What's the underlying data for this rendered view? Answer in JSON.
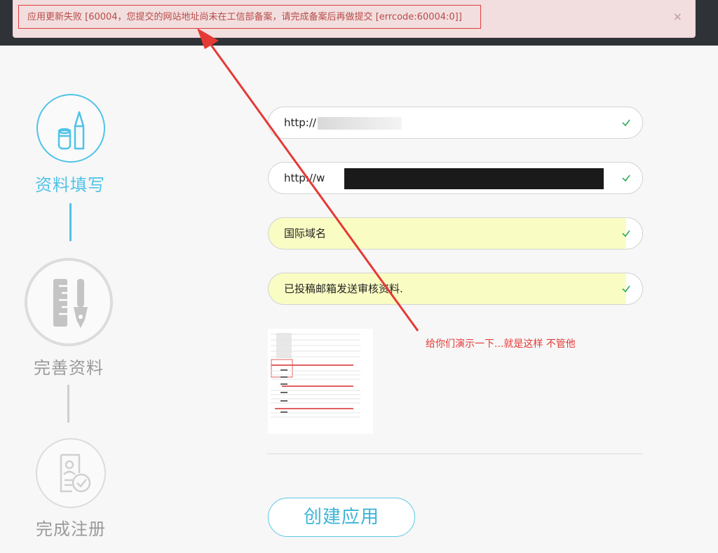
{
  "error_banner": {
    "message": "应用更新失败 [60004，您提交的网站地址尚未在工信部备案，请完成备案后再做提交 [errcode:60004:0]]",
    "close_symbol": "×"
  },
  "steps": [
    {
      "label": "资料填写",
      "icon": "pencil-ruler-icon",
      "state": "active"
    },
    {
      "label": "完善资料",
      "icon": "ruler-pen-icon",
      "state": "inactive"
    },
    {
      "label": "完成注册",
      "icon": "certificate-check-icon",
      "state": "inactive"
    }
  ],
  "form": {
    "fields": [
      {
        "value": "http://",
        "redacted": true,
        "valid": true
      },
      {
        "value": "http://w",
        "redacted": true,
        "valid": true
      },
      {
        "value": "国际域名",
        "valid": true
      },
      {
        "value": "已投稿邮箱发送审核资料.",
        "valid": true
      }
    ]
  },
  "annotation": {
    "text": "给你们演示一下...就是这样 不管他"
  },
  "actions": {
    "create_label": "创建应用"
  },
  "colors": {
    "accent": "#3db5d8",
    "active_step": "#4fc3e8",
    "inactive_step": "#c8c8c8",
    "valid_check": "#2eaa5c",
    "error_text": "#b94a48",
    "annotation_red": "#e53935",
    "autofill_bg": "#fafdc3"
  }
}
